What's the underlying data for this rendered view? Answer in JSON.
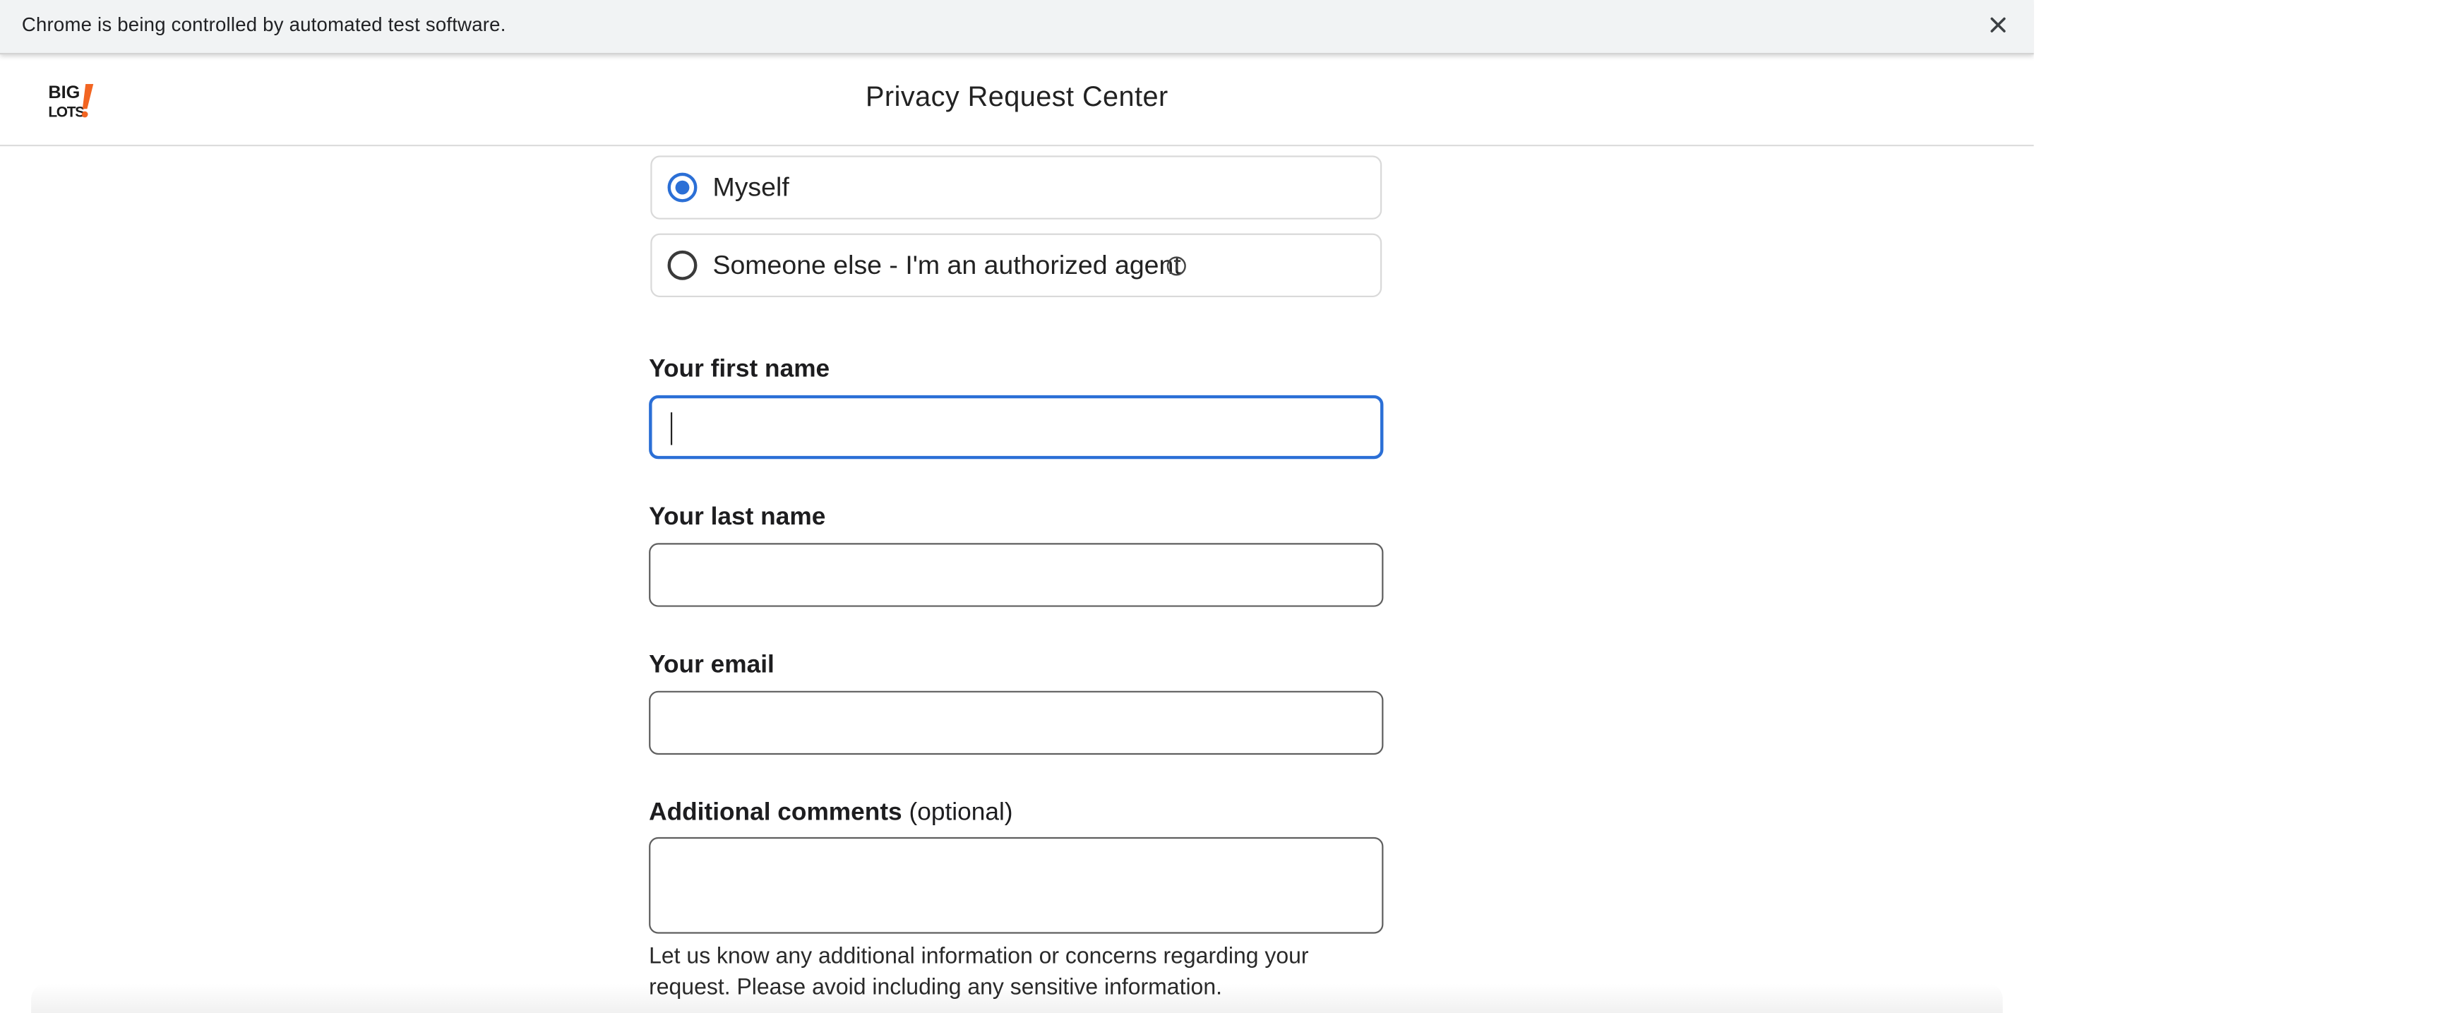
{
  "browser": {
    "infobar_text": "Chrome is being controlled by automated test software.",
    "close_icon": "close-icon"
  },
  "header": {
    "logo": {
      "line1": "BIG",
      "line2": "LOTS!",
      "accent_color": "#f26522"
    },
    "title": "Privacy Request Center"
  },
  "request_for": {
    "options": [
      {
        "label": "Myself",
        "selected": true
      },
      {
        "label": "Someone else - I'm an authorized agent",
        "selected": false,
        "icon": "info-icon"
      }
    ]
  },
  "form": {
    "first_name": {
      "label": "Your first name",
      "value": ""
    },
    "last_name": {
      "label": "Your last name",
      "value": ""
    },
    "email": {
      "label": "Your email",
      "value": ""
    },
    "comments": {
      "label": "Additional comments",
      "optional_label": "(optional)",
      "value": "",
      "helper": "Let us know any additional information or concerns regarding your request. Please avoid including any sensitive information."
    }
  },
  "colors": {
    "accent": "#2b6fd6",
    "infobar_bg": "#f1f3f4"
  }
}
